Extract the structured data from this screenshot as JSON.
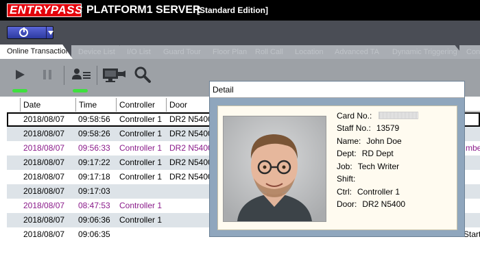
{
  "window": {
    "logo_text": "ENTRYPASS",
    "title": "PLATFORM1 SERVER",
    "edition": "[Standard Edition]"
  },
  "tabs": [
    {
      "label": "Online Transaction",
      "active": true
    },
    {
      "label": "Device List"
    },
    {
      "label": "I/O List"
    },
    {
      "label": "Guard Tour"
    },
    {
      "label": "Floor Plan"
    },
    {
      "label": "Roll Call"
    },
    {
      "label": "Location"
    },
    {
      "label": "Advanced TA"
    },
    {
      "label": "Dynamic Triggering"
    },
    {
      "label": "Con"
    }
  ],
  "grid": {
    "columns": [
      "Date",
      "Time",
      "Controller",
      "Door"
    ],
    "rows": [
      {
        "date": "2018/08/07",
        "time": "09:58:56",
        "controller": "Controller 1",
        "door": "DR2 N5400",
        "extra": ""
      },
      {
        "date": "2018/08/07",
        "time": "09:58:26",
        "controller": "Controller 1",
        "door": "DR2 N5400",
        "extra": ""
      },
      {
        "date": "2018/08/07",
        "time": "09:56:33",
        "controller": "Controller 1",
        "door": "DR2 N5400",
        "extra": "mbe"
      },
      {
        "date": "2018/08/07",
        "time": "09:17:22",
        "controller": "Controller 1",
        "door": "DR2 N5400",
        "extra": ""
      },
      {
        "date": "2018/08/07",
        "time": "09:17:18",
        "controller": "Controller 1",
        "door": "DR2 N5400",
        "extra": ""
      },
      {
        "date": "2018/08/07",
        "time": "09:17:03",
        "controller": "",
        "door": "",
        "extra": ""
      },
      {
        "date": "2018/08/07",
        "time": "08:47:53",
        "controller": "Controller 1",
        "door": "",
        "extra": ""
      },
      {
        "date": "2018/08/07",
        "time": "09:06:36",
        "controller": "Controller 1",
        "door": "",
        "extra": ""
      },
      {
        "date": "2018/08/07",
        "time": "09:06:35",
        "controller": "",
        "door": "",
        "extra": "Start"
      }
    ]
  },
  "detail": {
    "title": "Detail",
    "card_label": "Card No.:",
    "staff_label": "Staff No.:",
    "staff_value": "13579",
    "name_label": "Name:",
    "name_value": "John Doe",
    "dept_label": "Dept:",
    "dept_value": "RD Dept",
    "job_label": "Job:",
    "job_value": "Tech Writer",
    "shift_label": "Shift:",
    "shift_value": "",
    "ctrl_label": "Ctrl:",
    "ctrl_value": "Controller 1",
    "door_label": "Door:",
    "door_value": "DR2 N5400"
  },
  "colors": {
    "titlebar": "#000000",
    "logo_red": "#e3000b",
    "menubar": "#4a4d55",
    "toolbar": "#9da1a6",
    "indicator_green": "#3ee03e",
    "row_alt": "#dde3e8",
    "purple_text": "#8a1a8a",
    "detail_frame": "#8fa6bd",
    "detail_panel": "#fffbf0"
  },
  "icons": {
    "power": "power-icon",
    "play": "play-icon",
    "pause": "pause-icon",
    "user_card": "user-card-icon",
    "monitor_camera": "monitor-camera-icon",
    "search": "search-icon"
  }
}
